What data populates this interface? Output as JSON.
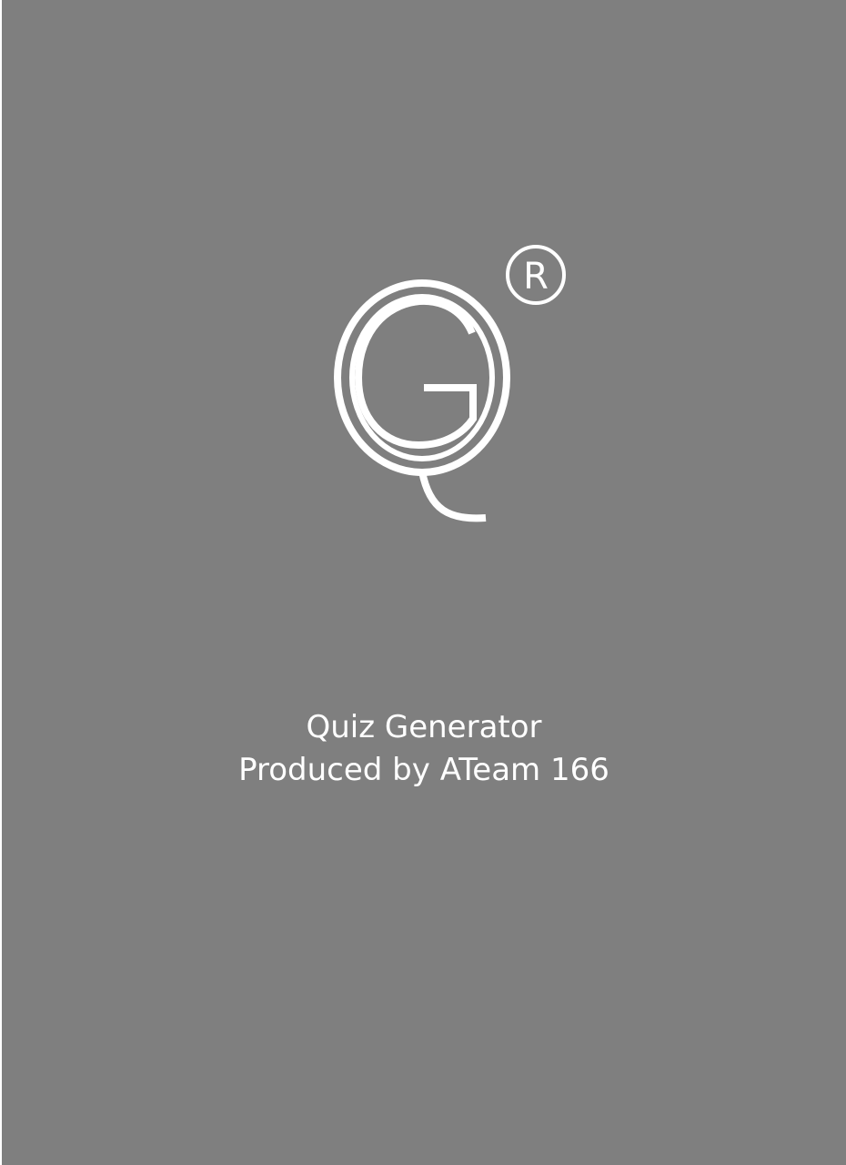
{
  "splash": {
    "background_color": "#7f7f7f",
    "foreground_color": "#ffffff",
    "logo": {
      "name": "qg-logo-icon",
      "registered_mark": "R"
    },
    "app_name": "Quiz Generator",
    "credit": "Produced by ATeam 166"
  }
}
